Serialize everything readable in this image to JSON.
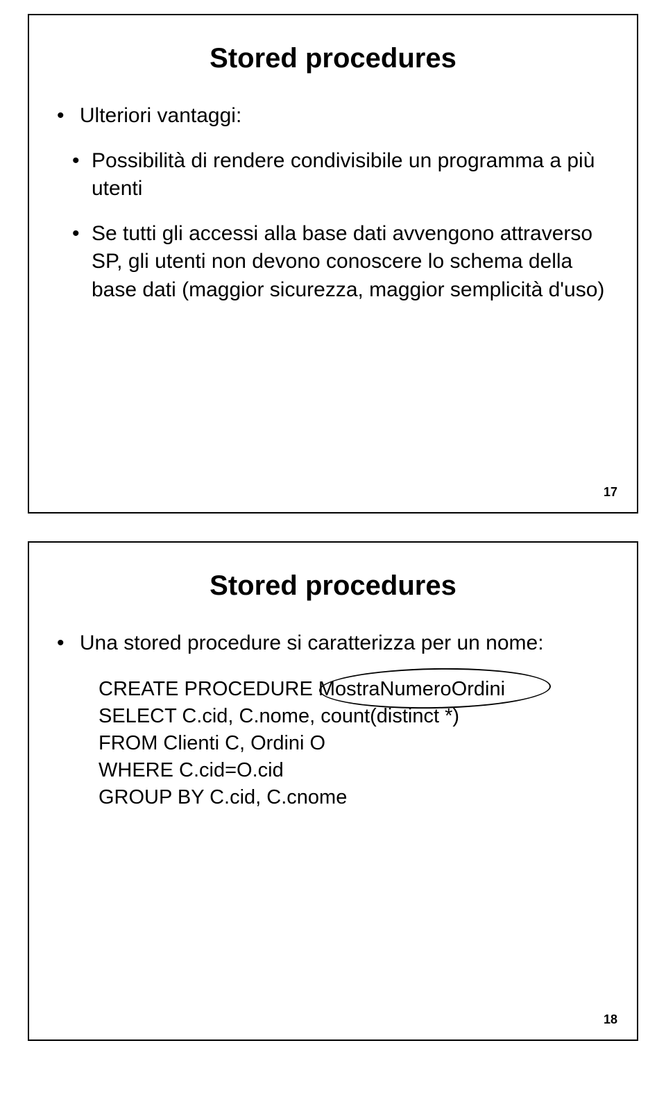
{
  "slide1": {
    "title": "Stored procedures",
    "bullet1": "Ulteriori vantaggi:",
    "sub1": "Possibilità di rendere condivisibile un programma a più utenti",
    "sub2": "Se tutti gli accessi alla base dati avvengono attraverso SP, gli utenti non devono conoscere lo schema della base dati (maggior sicurezza, maggior semplicità d'uso)",
    "pagenum": "17"
  },
  "slide2": {
    "title": "Stored procedures",
    "bullet1": "Una stored procedure si caratterizza per un nome:",
    "code_line1": "CREATE PROCEDURE MostraNumeroOrdini",
    "code_line2": "SELECT C.cid, C.nome, count(distinct *)",
    "code_line3": "FROM Clienti C, Ordini O",
    "code_line4": "WHERE C.cid=O.cid",
    "code_line5": "GROUP BY C.cid, C.cnome",
    "pagenum": "18"
  }
}
